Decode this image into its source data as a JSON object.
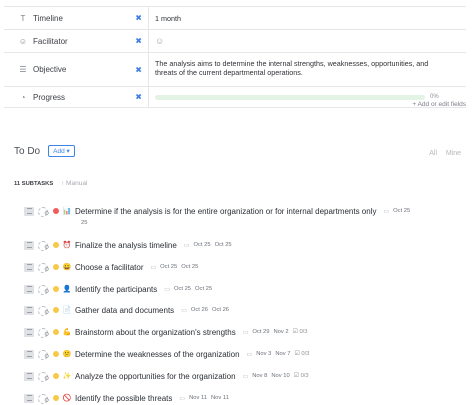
{
  "fields": {
    "timeline": {
      "label": "Timeline",
      "value": "1 month"
    },
    "facilitator": {
      "label": "Facilitator"
    },
    "objective": {
      "label": "Objective",
      "value": "The analysis aims to determine the internal strengths, weaknesses, opportunities, and threats of the current departmental operations."
    },
    "progress": {
      "label": "Progress",
      "fraction": 0.0,
      "text": "0%"
    },
    "add_link": "+ Add or edit fields"
  },
  "section": {
    "title": "To Do",
    "add_label": "Add ▾",
    "filter_all": "All",
    "filter_mine": "Mine",
    "subtasks_count": "11 SUBTASKS",
    "sort_label": "↑ Manual"
  },
  "tasks": [
    {
      "name": "Determine if the analysis is for the entire organization or for internal departments only",
      "emoji": "📊",
      "status": "red",
      "start": "",
      "due": "Oct 25"
    },
    {
      "name": "Finalize the analysis timeline",
      "emoji": "⏰",
      "status": "yellow",
      "start": "Oct 25",
      "due": "Oct 25"
    },
    {
      "name": "Choose a facilitator",
      "emoji": "😀",
      "status": "yellow",
      "start": "Oct 25",
      "due": "Oct 25"
    },
    {
      "name": "Identify the participants",
      "emoji": "👤",
      "status": "yellow",
      "start": "Oct 25",
      "due": "Oct 25"
    },
    {
      "name": "Gather data and documents",
      "emoji": "📄",
      "status": "yellow",
      "start": "Oct 26",
      "due": "Oct 26"
    },
    {
      "name": "Brainstorm about the organization's strengths",
      "emoji": "💪",
      "status": "yellow",
      "start": "Oct 29",
      "due": "Nov 2",
      "checklist": "0/3"
    },
    {
      "name": "Determine the weaknesses of the organization",
      "emoji": "😕",
      "status": "yellow",
      "start": "Nov 3",
      "due": "Nov 7",
      "checklist": "0/3"
    },
    {
      "name": "Analyze the opportunities for the organization",
      "emoji": "✨",
      "status": "yellow",
      "start": "Nov 8",
      "due": "Nov 10",
      "checklist": "0/3"
    },
    {
      "name": "Identify the possible threats",
      "emoji": "🚫",
      "status": "yellow",
      "start": "Nov 11",
      "due": "Nov 11"
    }
  ],
  "task0_due_overflow": "25",
  "colors": {
    "accent": "#3d83e8",
    "progress": "#3ec46d",
    "status_red": "#f05b5b",
    "status_yellow": "#f7c948"
  }
}
